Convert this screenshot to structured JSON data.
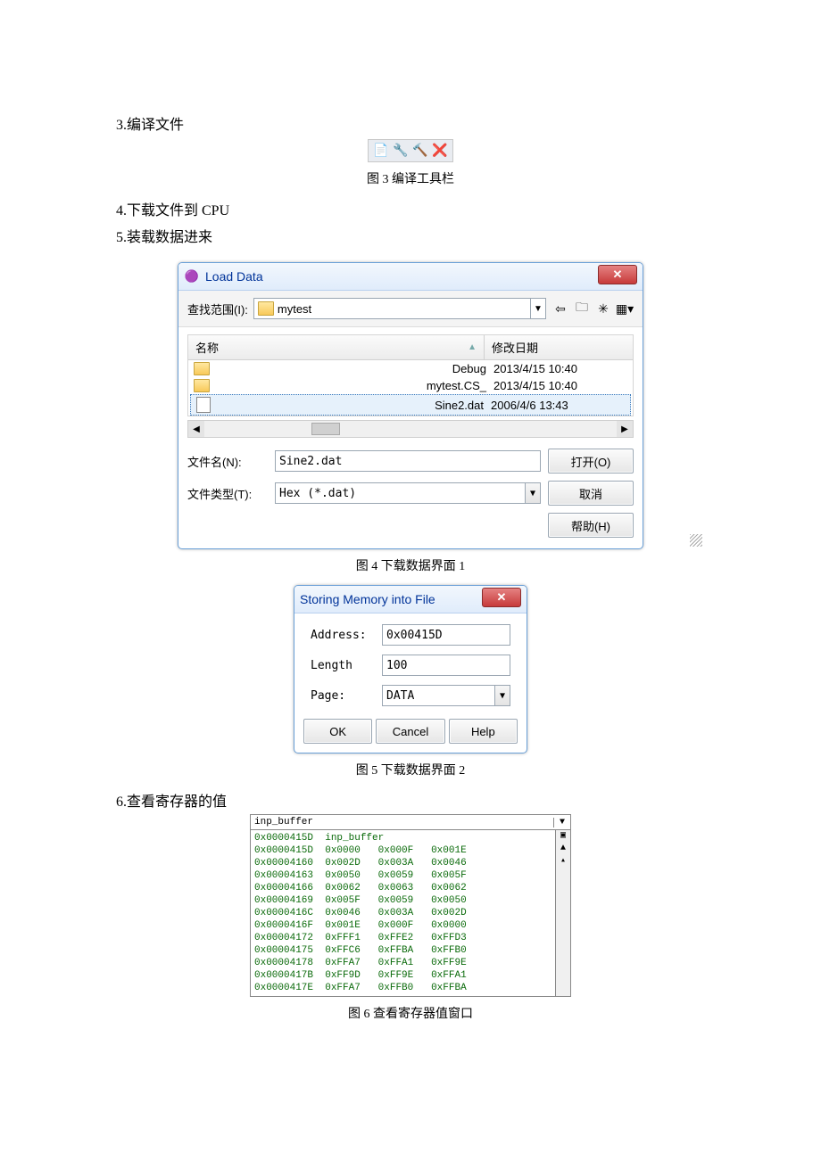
{
  "sections": {
    "s3": "3.编译文件",
    "s4": "4.下载文件到 CPU",
    "s5": "5.装载数据进来",
    "s6": "6.查看寄存器的值"
  },
  "captions": {
    "fig3": "图 3  编译工具栏",
    "fig4": "图 4  下载数据界面 1",
    "fig5": "图 5  下载数据界面 2",
    "fig6": "图 6  查看寄存器值窗口"
  },
  "loadData": {
    "title": "Load Data",
    "lookin_label": "查找范围(I):",
    "lookin_value": "mytest",
    "header_name": "名称",
    "header_date": "修改日期",
    "rows": [
      {
        "name": "Debug",
        "date": "2013/4/15 10:40",
        "type": "folder"
      },
      {
        "name": "mytest.CS_",
        "date": "2013/4/15 10:40",
        "type": "folder"
      },
      {
        "name": "Sine2.dat",
        "date": "2006/4/6 13:43",
        "type": "file",
        "selected": true
      }
    ],
    "filename_label": "文件名(N):",
    "filename_value": "Sine2.dat",
    "filetype_label": "文件类型(T):",
    "filetype_value": "Hex (*.dat)",
    "open_btn": "打开(O)",
    "cancel_btn": "取消",
    "help_btn": "帮助(H)"
  },
  "memDialog": {
    "title": "Storing Memory into File",
    "address_label": "Address:",
    "address_value": "0x00415D",
    "length_label": "Length",
    "length_value": "100",
    "page_label": "Page:",
    "page_value": "DATA",
    "ok": "OK",
    "cancel": "Cancel",
    "help": "Help"
  },
  "regWindow": {
    "name": "inp_buffer",
    "firstLabel": "inp_buffer",
    "rows": [
      {
        "addr": "0x0000415D",
        "v": [
          "0x0000",
          "0x000F",
          "0x001E"
        ]
      },
      {
        "addr": "0x00004160",
        "v": [
          "0x002D",
          "0x003A",
          "0x0046"
        ]
      },
      {
        "addr": "0x00004163",
        "v": [
          "0x0050",
          "0x0059",
          "0x005F"
        ]
      },
      {
        "addr": "0x00004166",
        "v": [
          "0x0062",
          "0x0063",
          "0x0062"
        ]
      },
      {
        "addr": "0x00004169",
        "v": [
          "0x005F",
          "0x0059",
          "0x0050"
        ]
      },
      {
        "addr": "0x0000416C",
        "v": [
          "0x0046",
          "0x003A",
          "0x002D"
        ]
      },
      {
        "addr": "0x0000416F",
        "v": [
          "0x001E",
          "0x000F",
          "0x0000"
        ]
      },
      {
        "addr": "0x00004172",
        "v": [
          "0xFFF1",
          "0xFFE2",
          "0xFFD3"
        ]
      },
      {
        "addr": "0x00004175",
        "v": [
          "0xFFC6",
          "0xFFBA",
          "0xFFB0"
        ]
      },
      {
        "addr": "0x00004178",
        "v": [
          "0xFFA7",
          "0xFFA1",
          "0xFF9E"
        ]
      },
      {
        "addr": "0x0000417B",
        "v": [
          "0xFF9D",
          "0xFF9E",
          "0xFFA1"
        ]
      },
      {
        "addr": "0x0000417E",
        "v": [
          "0xFFA7",
          "0xFFB0",
          "0xFFBA"
        ]
      }
    ]
  }
}
